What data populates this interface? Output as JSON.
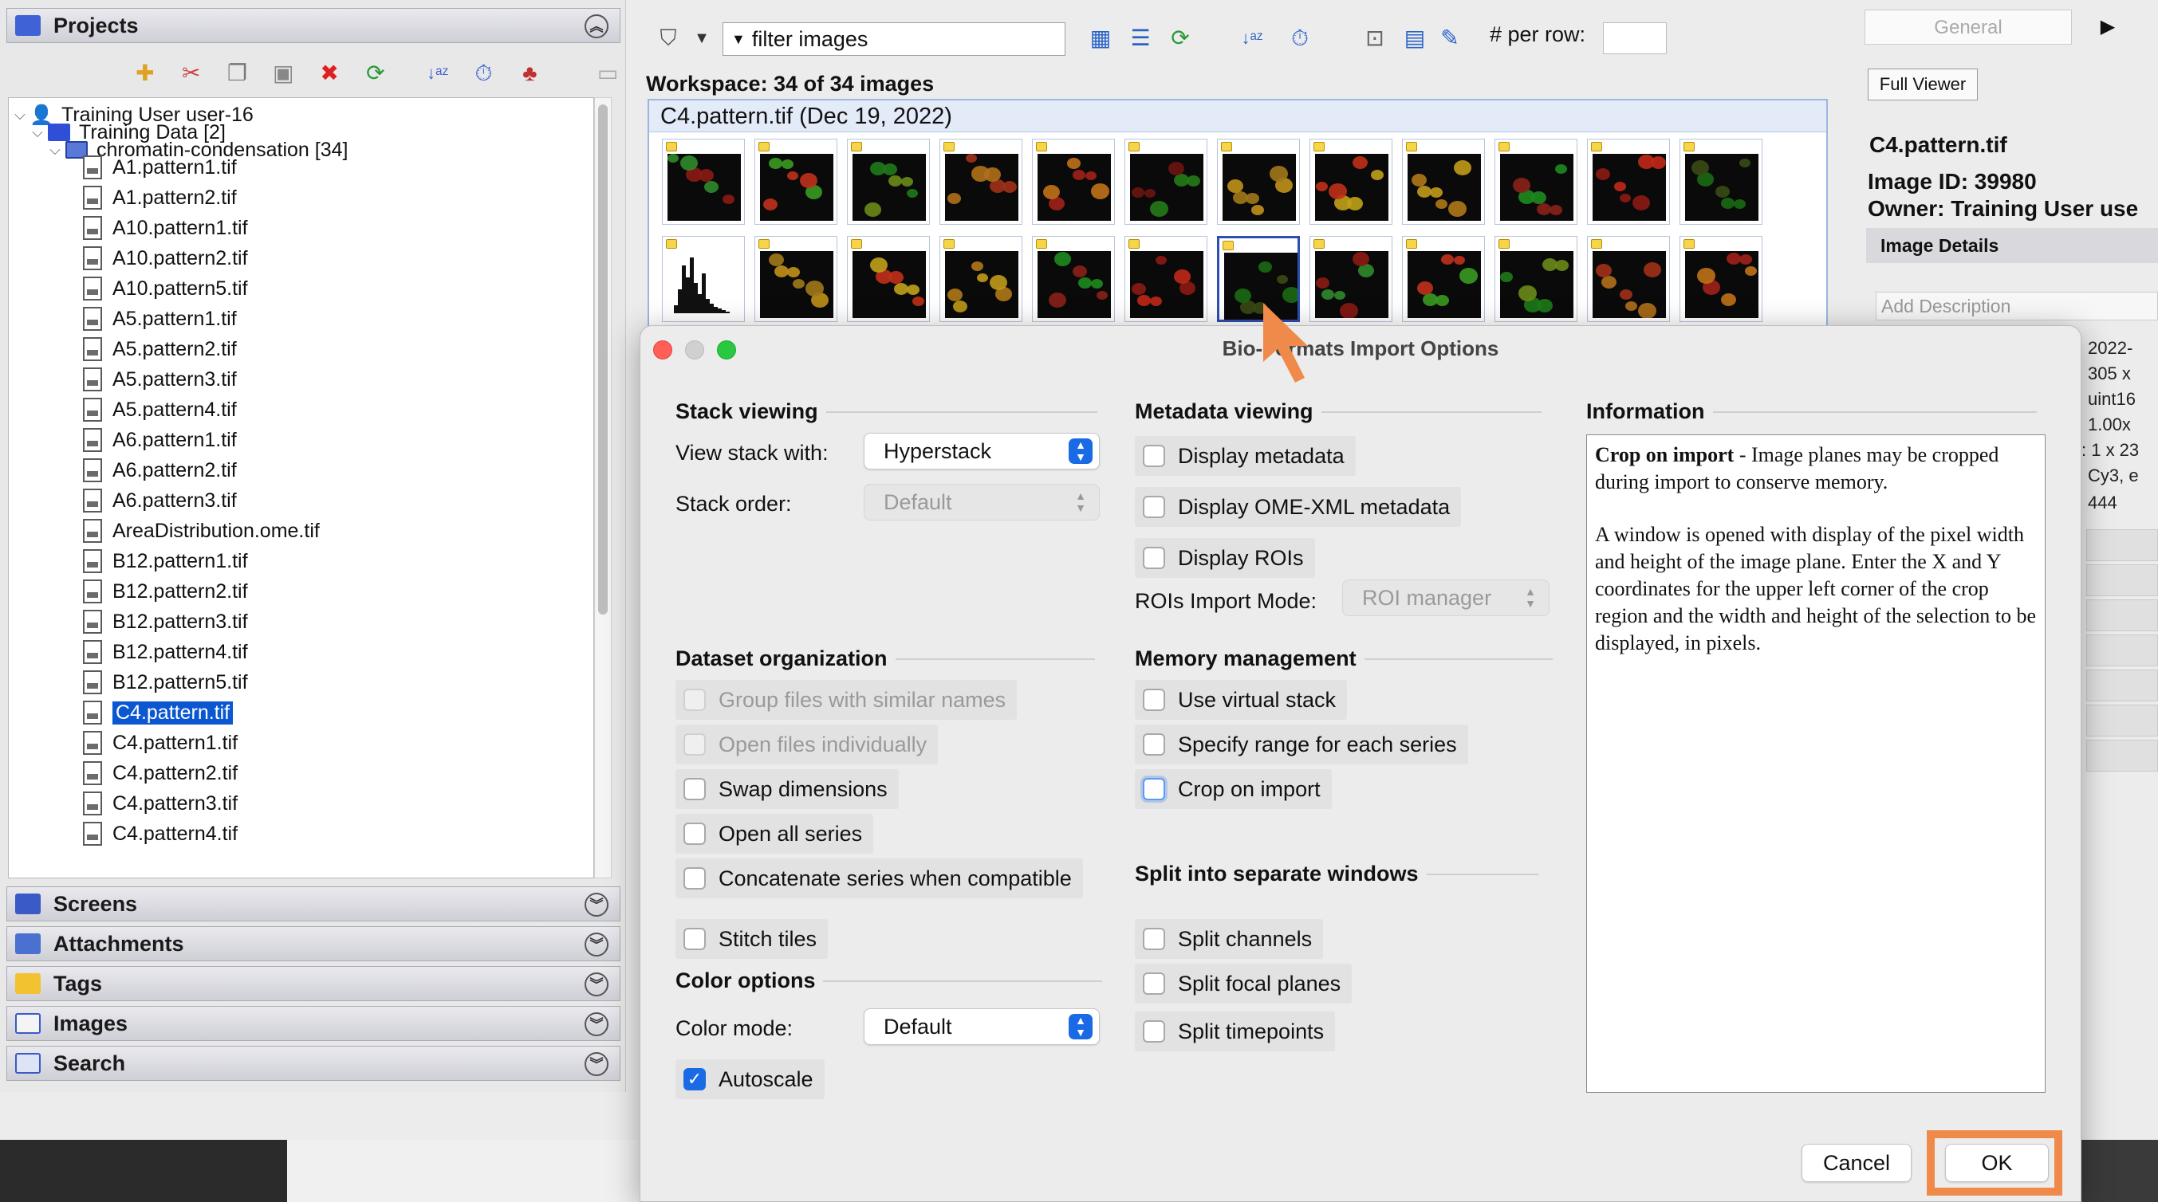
{
  "left_panel": {
    "projects_header": "Projects",
    "toolbar_icons": [
      "new-item-icon",
      "cut-icon",
      "copy-icon",
      "paste-icon",
      "delete-icon",
      "refresh-icon",
      "sort-az-icon",
      "clock-icon",
      "shapes-icon",
      "collapse-icon"
    ],
    "tree": {
      "user": "Training User user-16",
      "project": "Training Data [2]",
      "dataset": "chromatin-condensation [34]",
      "files": [
        "A1.pattern1.tif",
        "A1.pattern2.tif",
        "A10.pattern1.tif",
        "A10.pattern2.tif",
        "A10.pattern5.tif",
        "A5.pattern1.tif",
        "A5.pattern2.tif",
        "A5.pattern3.tif",
        "A5.pattern4.tif",
        "A6.pattern1.tif",
        "A6.pattern2.tif",
        "A6.pattern3.tif",
        "AreaDistribution.ome.tif",
        "B12.pattern1.tif",
        "B12.pattern2.tif",
        "B12.pattern3.tif",
        "B12.pattern4.tif",
        "B12.pattern5.tif",
        "C4.pattern.tif",
        "C4.pattern1.tif",
        "C4.pattern2.tif",
        "C4.pattern3.tif",
        "C4.pattern4.tif"
      ],
      "selected_file": "C4.pattern.tif"
    },
    "sections": [
      "Screens",
      "Attachments",
      "Tags",
      "Images",
      "Search"
    ]
  },
  "workspace": {
    "filter_placeholder": "filter  images",
    "per_row_label": "# per row:",
    "per_row_value": "",
    "workspace_label": "Workspace: 34 of 34 images",
    "panel_title": "C4.pattern.tif (Dec 19, 2022)"
  },
  "right_panel": {
    "tab_label": "General",
    "full_viewer_button": "Full Viewer",
    "file_name": "C4.pattern.tif",
    "image_id": "Image ID: 39980",
    "owner": "Owner: Training User use",
    "details_header": "Image Details",
    "description_placeholder": "Add Description",
    "meta": [
      "2022-",
      "305 x",
      "uint16",
      "1.00x",
      ": 1 x 23",
      "Cy3, e",
      "444"
    ]
  },
  "dialog": {
    "title": "Bio-Formats Import Options",
    "stack_viewing": {
      "title": "Stack viewing",
      "view_stack_label": "View stack with:",
      "view_stack_value": "Hyperstack",
      "stack_order_label": "Stack order:",
      "stack_order_value": "Default"
    },
    "dataset_org": {
      "title": "Dataset organization",
      "group_files": "Group files with similar names",
      "open_individually": "Open files individually",
      "swap_dimensions": "Swap dimensions",
      "open_all_series": "Open all series",
      "concatenate": "Concatenate series when compatible",
      "stitch_tiles": "Stitch tiles"
    },
    "color_options": {
      "title": "Color options",
      "color_mode_label": "Color mode:",
      "color_mode_value": "Default",
      "autoscale": "Autoscale"
    },
    "metadata_viewing": {
      "title": "Metadata viewing",
      "display_metadata": "Display metadata",
      "display_ome_xml": "Display OME-XML metadata",
      "display_rois": "Display ROIs",
      "rois_mode_label": "ROIs Import Mode:",
      "rois_mode_value": "ROI manager"
    },
    "memory": {
      "title": "Memory management",
      "virtual_stack": "Use virtual stack",
      "specify_range": "Specify range for each series",
      "crop_on_import": "Crop on import"
    },
    "split": {
      "title": "Split into separate windows",
      "split_channels": "Split channels",
      "split_focal": "Split focal planes",
      "split_timepoints": "Split timepoints"
    },
    "information": {
      "title": "Information",
      "heading": "Crop on import",
      "p1": " - Image planes may be cropped during import to conserve memory.",
      "p2": "A window is opened with display of the pixel width and height of the image plane. Enter the X and Y coordinates for the upper left corner of the crop region and the width and height of the selection to be displayed, in pixels."
    },
    "cancel_label": "Cancel",
    "ok_label": "OK"
  },
  "colors": {
    "accent": "#1a6ae6",
    "highlight": "#ef8a4a",
    "selection": "#0b57d0"
  }
}
